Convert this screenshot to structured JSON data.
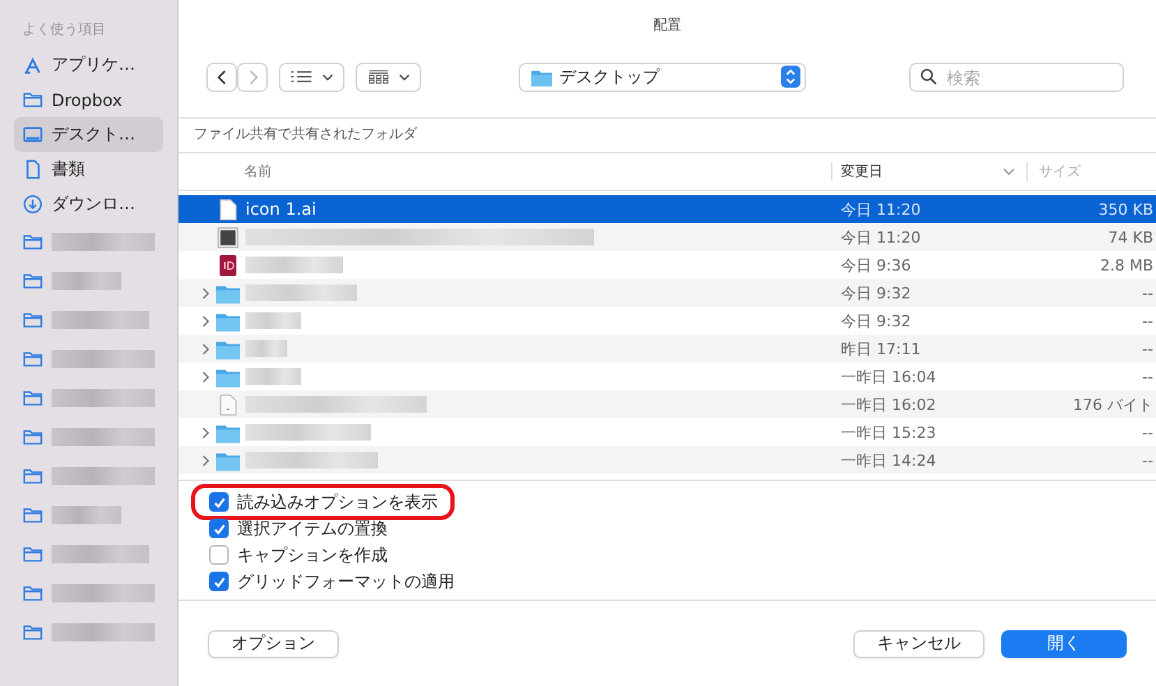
{
  "sidebar": {
    "heading": "よく使う項目",
    "items": [
      {
        "kind": "apps",
        "label": "アプリケ…",
        "selected": false
      },
      {
        "kind": "folder",
        "label": "Dropbox",
        "selected": false
      },
      {
        "kind": "desktop",
        "label": "デスクト…",
        "selected": true
      },
      {
        "kind": "document",
        "label": "書類",
        "selected": false
      },
      {
        "kind": "download",
        "label": "ダウンロ…",
        "selected": false
      },
      {
        "kind": "folder-redacted",
        "selected": false
      },
      {
        "kind": "folder-redacted",
        "selected": false
      },
      {
        "kind": "folder-redacted",
        "selected": false
      },
      {
        "kind": "folder-redacted",
        "selected": false
      },
      {
        "kind": "folder-redacted",
        "selected": false
      },
      {
        "kind": "folder-redacted",
        "selected": false
      },
      {
        "kind": "folder-redacted",
        "selected": false
      },
      {
        "kind": "folder-redacted",
        "selected": false
      },
      {
        "kind": "folder-redacted",
        "selected": false
      },
      {
        "kind": "folder-redacted",
        "selected": false
      },
      {
        "kind": "folder-redacted",
        "selected": false
      }
    ]
  },
  "window": {
    "title": "配置"
  },
  "toolbar": {
    "location": "デスクトップ",
    "search": {
      "placeholder": "検索"
    }
  },
  "section": {
    "title": "ファイル共有で共有されたフォルダ"
  },
  "table": {
    "columns": [
      "名前",
      "変更日",
      "サイズ"
    ],
    "rows": [
      {
        "kind": "ai-file",
        "name": "icon 1.ai",
        "date": "今日 11:20",
        "size": "350 KB",
        "selected": true
      },
      {
        "kind": "dark-file",
        "date": "今日 11:20",
        "size": "74 KB",
        "selected": false
      },
      {
        "kind": "indesign-file",
        "date": "今日 9:36",
        "size": "2.8 MB",
        "selected": false
      },
      {
        "kind": "folder",
        "date": "今日 9:32",
        "size": "--",
        "selected": false
      },
      {
        "kind": "folder",
        "date": "今日 9:32",
        "size": "--",
        "selected": false
      },
      {
        "kind": "folder",
        "date": "昨日 17:11",
        "size": "--",
        "selected": false
      },
      {
        "kind": "folder",
        "date": "一昨日 16:04",
        "size": "--",
        "selected": false
      },
      {
        "kind": "text-file",
        "date": "一昨日 16:02",
        "size": "176 バイト",
        "selected": false
      },
      {
        "kind": "folder",
        "date": "一昨日 15:23",
        "size": "--",
        "selected": false
      },
      {
        "kind": "folder",
        "date": "一昨日 14:24",
        "size": "--",
        "selected": false
      }
    ]
  },
  "options": [
    {
      "label": "読み込みオプションを表示",
      "checked": true,
      "highlighted": true
    },
    {
      "label": "選択アイテムの置換",
      "checked": true,
      "highlighted": false
    },
    {
      "label": "キャプションを作成",
      "checked": false,
      "highlighted": false
    },
    {
      "label": "グリッドフォーマットの適用",
      "checked": true,
      "highlighted": false
    }
  ],
  "buttons": {
    "options": "オプション",
    "cancel": "キャンセル",
    "open": "開く"
  }
}
